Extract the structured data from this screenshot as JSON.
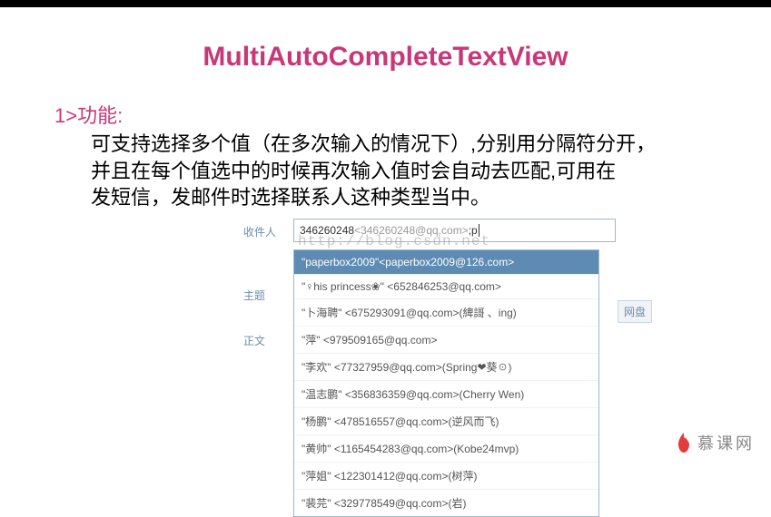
{
  "title": "MultiAutoCompleteTextView",
  "section_heading": "1>功能:",
  "section_body_l1": "可支持选择多个值（在多次输入的情况下）,分别用分隔符分开，",
  "section_body_l2": "并且在每个值选中的时候再次输入值时会自动去匹配,可用在",
  "section_body_l3": "发短信，发邮件时选择联系人这种类型当中。",
  "demo": {
    "watermark": "http://blog.csdn.net",
    "labels": {
      "to": "收件人",
      "subject": "主题",
      "body": "正文"
    },
    "input": {
      "first_name": "346260248",
      "first_addr": "<346260248@qq.com>",
      "sep": "; ",
      "partial": "p"
    },
    "dropdown": {
      "selected": "\"paperbox2009\"<paperbox2009@126.com>",
      "items": [
        "\"♀his princess❀\" <652846253@qq.com>",
        "\"卜海聘\" <675293091@qq.com>(綼謌 、ing)",
        "\"萍\" <979509165@qq.com>",
        "\"李欢\" <77327959@qq.com>(Spring❤葵☉)",
        "\"温志鹏\" <356836359@qq.com>(Cherry Wen)",
        "\"杨鹏\" <478516557@qq.com>(逆风而飞)",
        "\"黄帅\" <1165454283@qq.com>(Kobe24mvp)",
        "\"萍姐\" <122301412@qq.com>(树萍)",
        "\"裴芫\" <329778549@qq.com>(岩)"
      ]
    },
    "side_tag": "网盘"
  },
  "brand": {
    "flame": "♦",
    "text": "慕课网"
  }
}
